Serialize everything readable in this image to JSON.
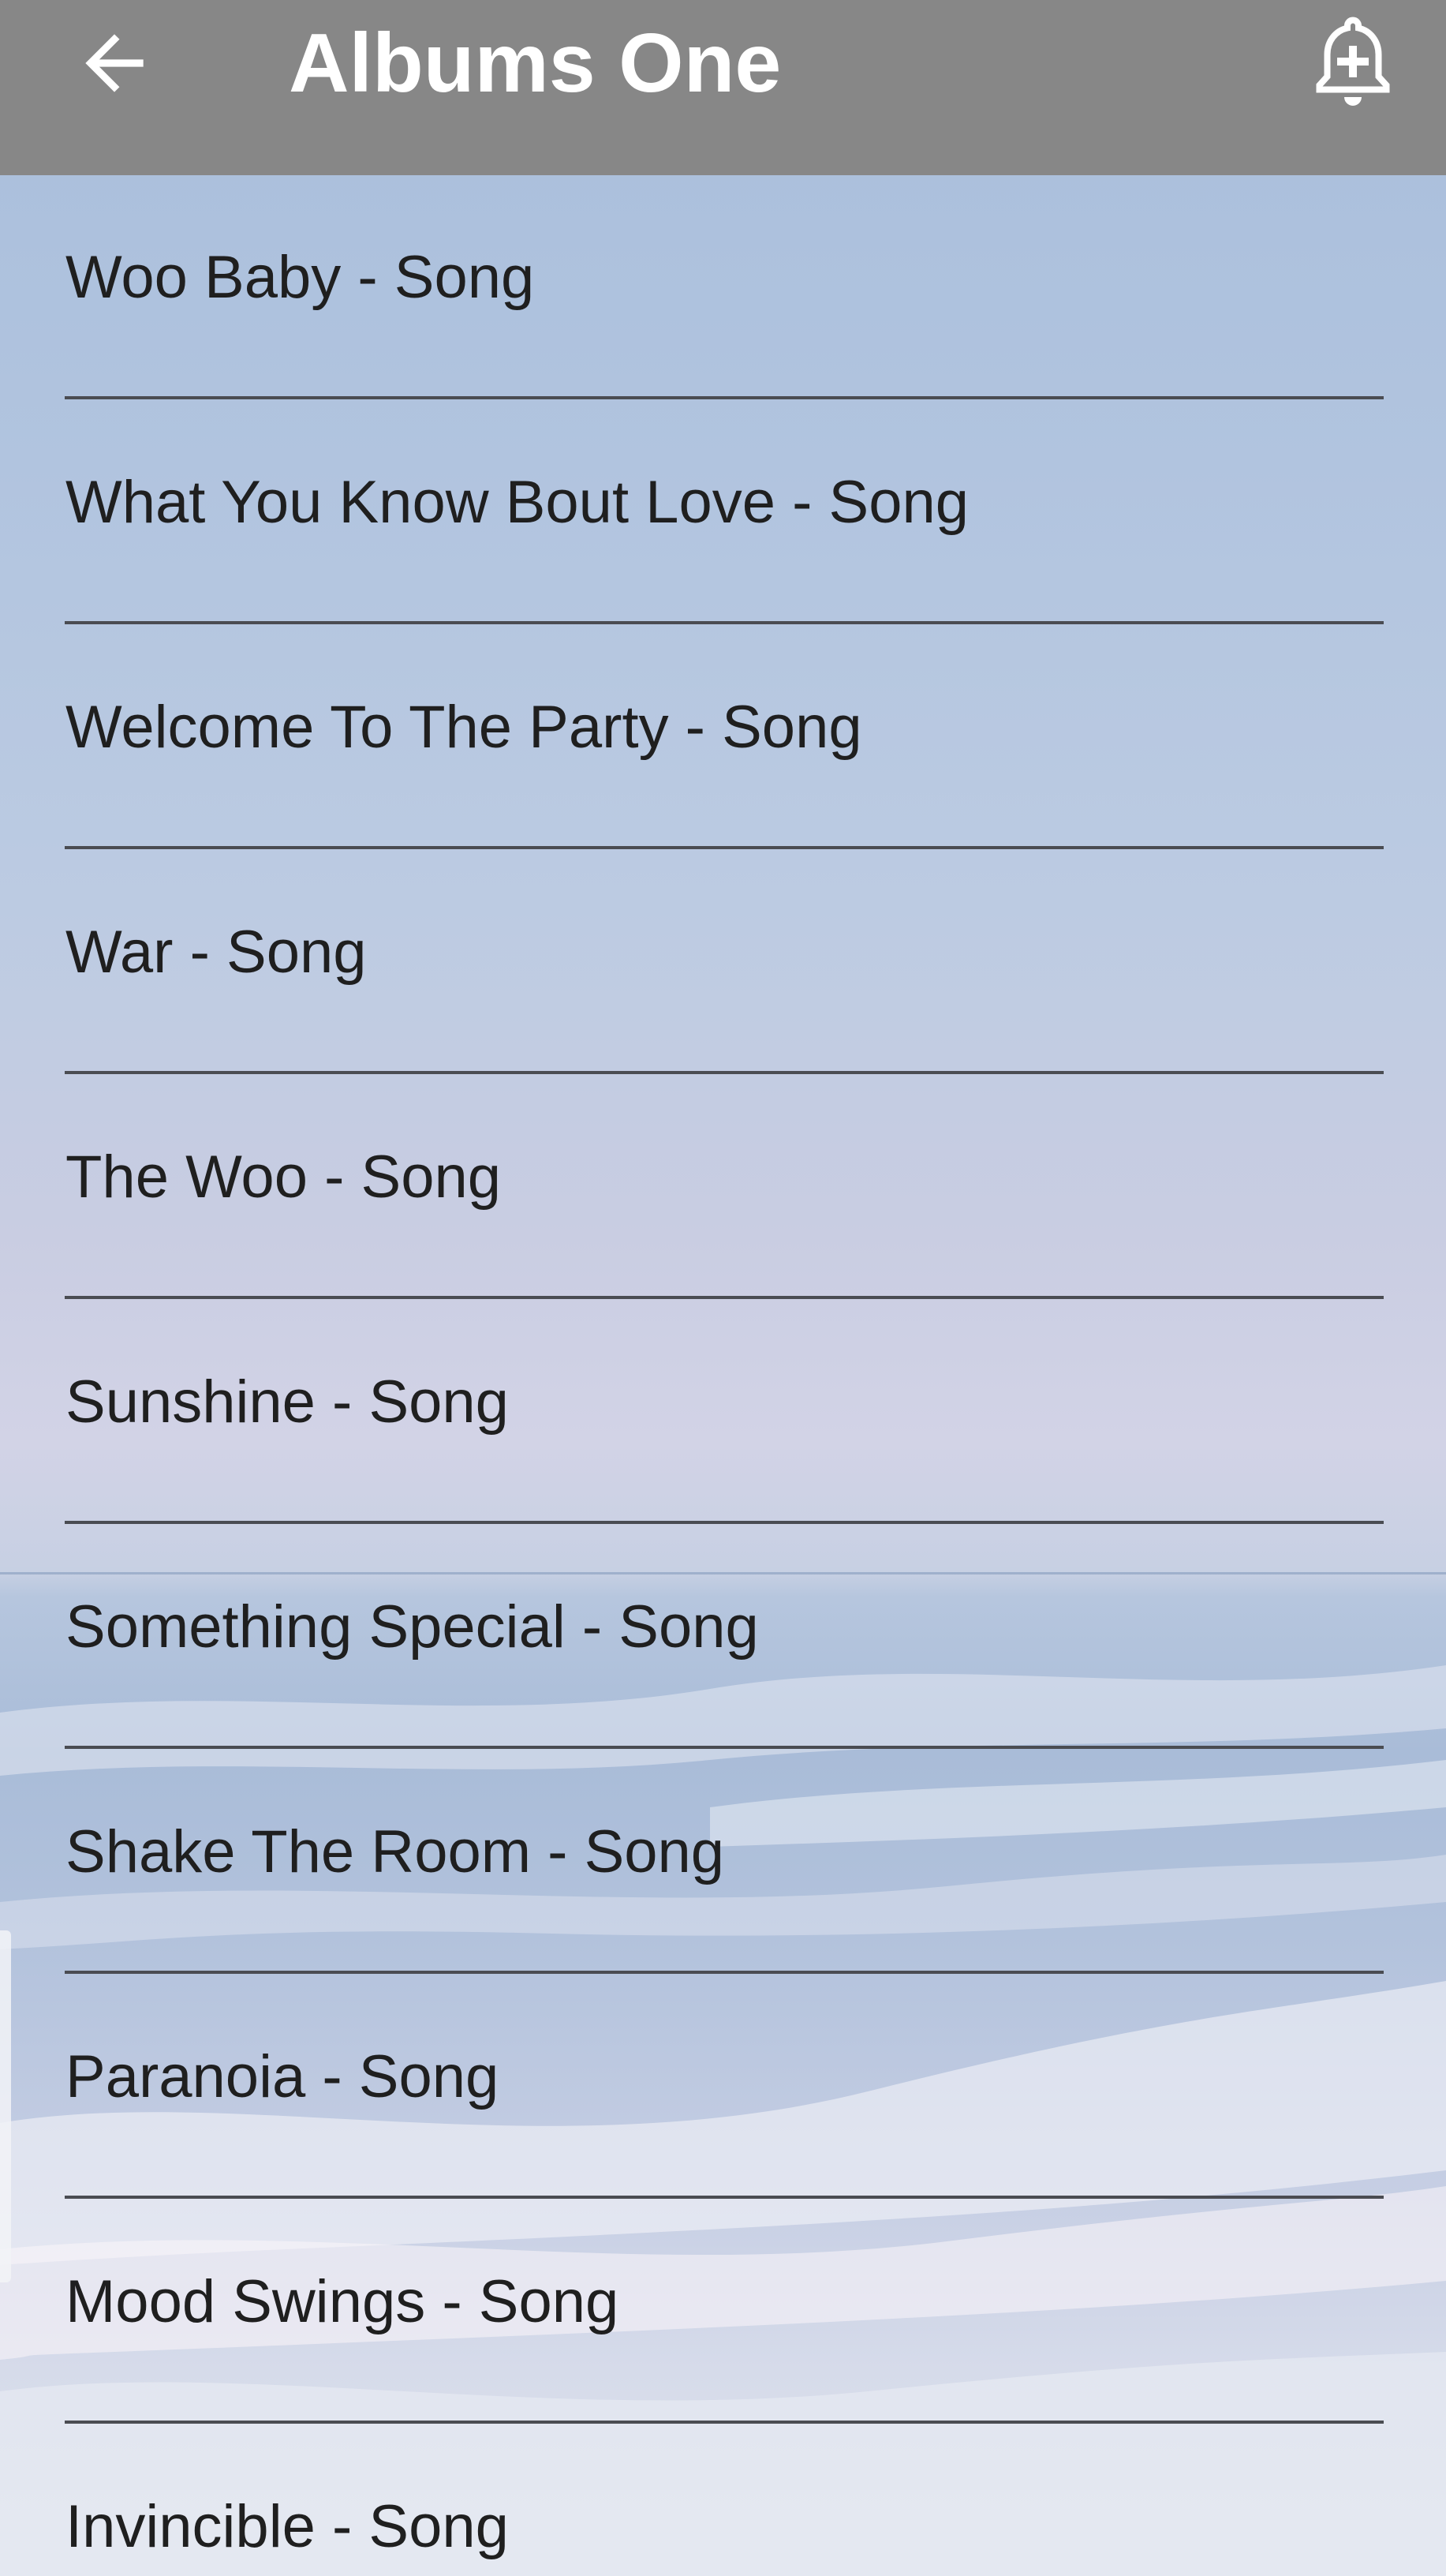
{
  "app_bar": {
    "title": "Albums One",
    "back_icon": "arrow-back-icon",
    "action_icon": "add-alarm-icon",
    "background_color": "#878787"
  },
  "songs": [
    {
      "label": "Woo Baby - Song"
    },
    {
      "label": "What You Know Bout Love - Song"
    },
    {
      "label": "Welcome To The Party - Song"
    },
    {
      "label": "War - Song"
    },
    {
      "label": "The Woo - Song"
    },
    {
      "label": "Sunshine - Song"
    },
    {
      "label": "Something Special - Song"
    },
    {
      "label": "Shake The Room - Song"
    },
    {
      "label": "Paranoia - Song"
    },
    {
      "label": "Mood Swings - Song"
    },
    {
      "label": "Invincible - Song"
    }
  ],
  "colors": {
    "text": "#1f1f1f",
    "divider": "#4a4c52",
    "background_sky": "#b1c4df"
  }
}
